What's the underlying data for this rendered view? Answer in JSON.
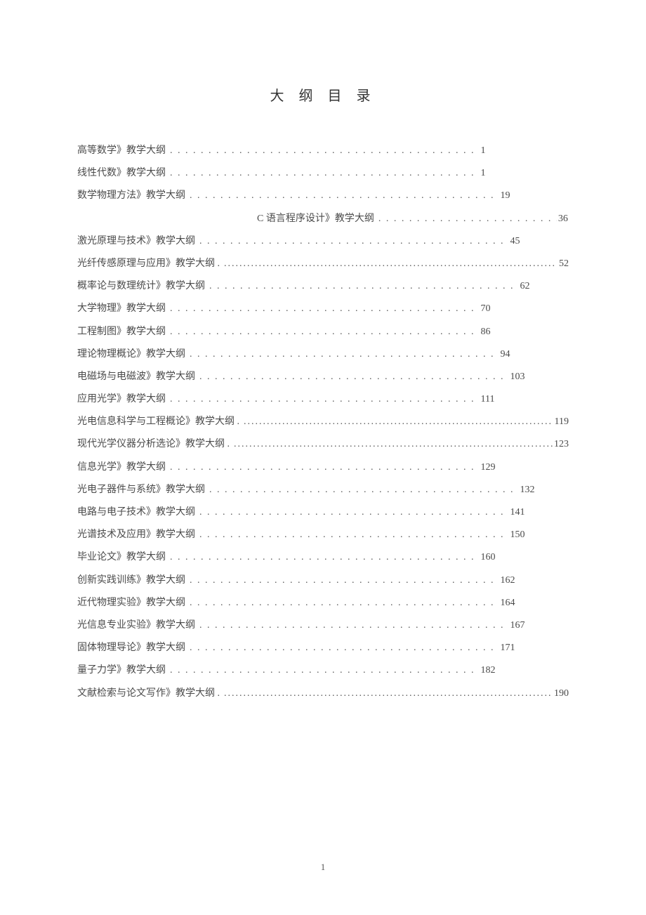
{
  "title": "大 纲 目 录",
  "page_number": "1",
  "toc": [
    {
      "label": "高等数学》教学大纲",
      "page": "1",
      "indented": false,
      "leader": "dot"
    },
    {
      "label": "线性代数》教学大纲",
      "page": "1",
      "indented": false,
      "leader": "dot"
    },
    {
      "label": "数学物理方法》教学大纲",
      "page": "19",
      "indented": false,
      "leader": "dot"
    },
    {
      "label": "C 语言程序设计》教学大纲",
      "page": "36",
      "indented": true,
      "leader": "dot"
    },
    {
      "label": "激光原理与技术》教学大纲",
      "page": "45",
      "indented": false,
      "leader": "dot"
    },
    {
      "label": "光纤传感原理与应用》教学大纲 .",
      "page": "52",
      "indented": false,
      "leader": "thin"
    },
    {
      "label": "概率论与数理统计》教学大纲",
      "page": "62",
      "indented": false,
      "leader": "dot"
    },
    {
      "label": "大学物理》教学大纲",
      "page": "70",
      "indented": false,
      "leader": "dot"
    },
    {
      "label": "工程制图》教学大纲",
      "page": "86",
      "indented": false,
      "leader": "dot"
    },
    {
      "label": "理论物理概论》教学大纲",
      "page": "94",
      "indented": false,
      "leader": "dot"
    },
    {
      "label": "电磁场与电磁波》教学大纲",
      "page": "103",
      "indented": false,
      "leader": "dot"
    },
    {
      "label": "应用光学》教学大纲",
      "page": "111",
      "indented": false,
      "leader": "dot"
    },
    {
      "label": "光电信息科学与工程概论》教学大纲 .",
      "page": "119",
      "indented": false,
      "leader": "thin"
    },
    {
      "label": "现代光学仪器分析选论》教学大纲 .",
      "page": "123",
      "indented": false,
      "leader": "thin"
    },
    {
      "label": "信息光学》教学大纲",
      "page": "129",
      "indented": false,
      "leader": "dot"
    },
    {
      "label": "光电子器件与系统》教学大纲",
      "page": "132",
      "indented": false,
      "leader": "dot"
    },
    {
      "label": "电路与电子技术》教学大纲",
      "page": "141",
      "indented": false,
      "leader": "dot"
    },
    {
      "label": "光谱技术及应用》教学大纲",
      "page": "150",
      "indented": false,
      "leader": "dot"
    },
    {
      "label": "毕业论文》教学大纲",
      "page": "160",
      "indented": false,
      "leader": "dot"
    },
    {
      "label": "创新实践训练》教学大纲",
      "page": "162",
      "indented": false,
      "leader": "dot"
    },
    {
      "label": "近代物理实验》教学大纲",
      "page": "164",
      "indented": false,
      "leader": "dot"
    },
    {
      "label": "光信息专业实验》教学大纲",
      "page": "167",
      "indented": false,
      "leader": "dot"
    },
    {
      "label": "固体物理导论》教学大纲",
      "page": "171",
      "indented": false,
      "leader": "dot"
    },
    {
      "label": "量子力学》教学大纲",
      "page": "182",
      "indented": false,
      "leader": "dot"
    },
    {
      "label": "文献检索与论文写作》教学大纲 .",
      "page": "190",
      "indented": false,
      "leader": "thin"
    }
  ]
}
